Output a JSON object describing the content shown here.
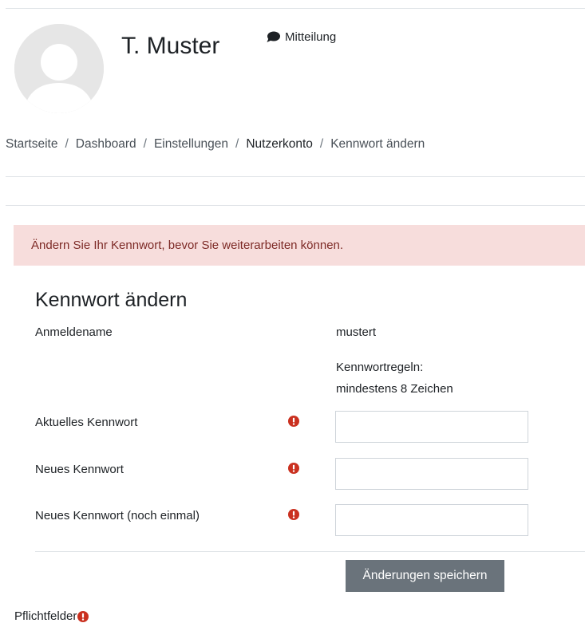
{
  "header": {
    "user_name": "T. Muster",
    "message_label": "Mitteilung"
  },
  "breadcrumb": {
    "items": [
      "Startseite",
      "Dashboard",
      "Einstellungen",
      "Nutzerkonto",
      "Kennwort ändern"
    ],
    "separator": "/"
  },
  "alert": {
    "text": "Ändern Sie Ihr Kennwort, bevor Sie weiterarbeiten können."
  },
  "form": {
    "title": "Kennwort ändern",
    "username_label": "Anmeldename",
    "username_value": "mustert",
    "rules_title": "Kennwortregeln:",
    "rules_text": "mindestens 8 Zeichen",
    "current_password_label": "Aktuelles Kennwort",
    "current_password_value": "",
    "new_password_label": "Neues Kennwort",
    "new_password_value": "",
    "new_password_repeat_label": "Neues Kennwort (noch einmal)",
    "new_password_repeat_value": "",
    "save_button": "Änderungen speichern",
    "required_note": "Pflichtfelder"
  },
  "colors": {
    "alert_bg": "#f7dddc",
    "alert_text": "#7d2a26",
    "required_icon": "#ca3120",
    "button_bg": "#6a737b"
  },
  "icons": {
    "avatar": "user-avatar-icon",
    "message": "speech-bubble-icon",
    "required": "exclamation-circle-icon"
  }
}
